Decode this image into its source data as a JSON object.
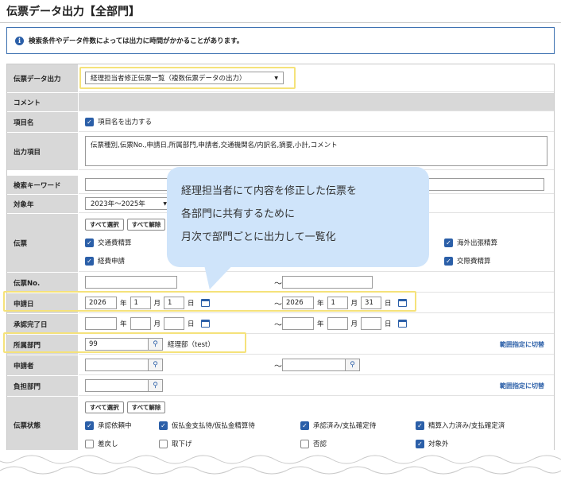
{
  "page": {
    "title": "伝票データ出力【全部門】"
  },
  "notice": {
    "text": "検索条件やデータ件数によっては出力に時間がかかることがあります。"
  },
  "rows": {
    "output_type": {
      "label": "伝票データ出力",
      "value": "経理担当者修正伝票一覧（複数伝票データの出力）"
    },
    "comment": {
      "label": "コメント"
    },
    "item_name": {
      "label": "項目名",
      "checkbox": "項目名を出力する"
    },
    "output_items": {
      "label": "出力項目",
      "value": "伝票種別,伝票No.,申請日,所属部門,申請者,交通機関名/内訳名,摘要,小計,コメント"
    },
    "keyword": {
      "label": "検索キーワード"
    },
    "year": {
      "label": "対象年",
      "value": "2023年～2025年"
    },
    "voucher": {
      "label": "伝票",
      "select_all": "すべて選択",
      "clear_all": "すべて解除",
      "items": [
        "交通費精算",
        "経費申請",
        "海外出張精算",
        "交際費精算"
      ]
    },
    "voucher_no": {
      "label": "伝票No.",
      "tilde": "～"
    },
    "apply_date": {
      "label": "申請日",
      "from": {
        "year": "2026",
        "month": "1",
        "day": "1"
      },
      "to": {
        "year": "2026",
        "month": "1",
        "day": "31"
      },
      "year_unit": "年",
      "month_unit": "月",
      "day_unit": "日",
      "tilde": "～"
    },
    "approval_date": {
      "label": "承認完了日",
      "year_unit": "年",
      "month_unit": "月",
      "day_unit": "日",
      "tilde": "～"
    },
    "department": {
      "label": "所属部門",
      "code": "99",
      "name": "経理部（test）",
      "link": "範囲指定に切替"
    },
    "applicant": {
      "label": "申請者",
      "tilde": "～"
    },
    "burden_dept": {
      "label": "負担部門",
      "link": "範囲指定に切替"
    },
    "status": {
      "label": "伝票状態",
      "select_all": "すべて選択",
      "clear_all": "すべて解除",
      "items": [
        "承認依頼中",
        "仮払金支払待/仮払金精算待",
        "承認済み/支払確定待",
        "精算入力済み/支払確定済",
        "差戻し",
        "取下げ",
        "否認",
        "対象外"
      ]
    }
  },
  "bubble": {
    "lines": [
      "経理担当者にて内容を修正した伝票を",
      "各部門に共有するために",
      "月次で部門ごとに出力して一覧化"
    ]
  },
  "colors": {
    "accent": "#2b5fa8",
    "highlight": "#f5e27a",
    "bubble": "#cfe4fa",
    "label_bg": "#d8d8d8"
  }
}
